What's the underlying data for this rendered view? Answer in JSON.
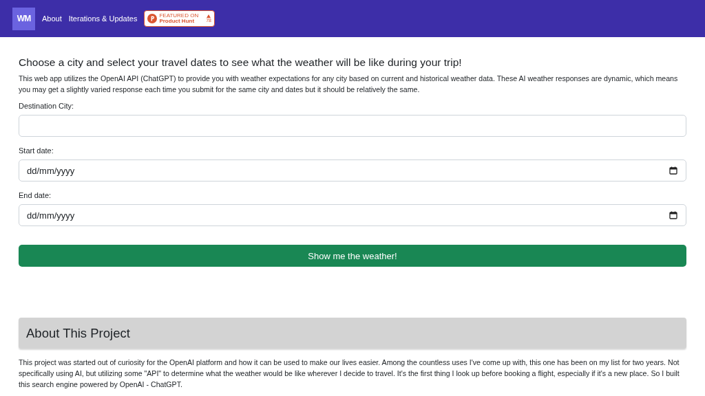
{
  "navbar": {
    "logo": "WM",
    "links": [
      "About",
      "Iterations & Updates"
    ],
    "badge": {
      "small": "FEATURED ON",
      "name": "Product Hunt",
      "count": "78"
    }
  },
  "form": {
    "heading": "Choose a city and select your travel dates to see what the weather will be like during your trip!",
    "intro": "This web app utilizes the OpenAI API (ChatGPT) to provide you with weather expectations for any city based on current and historical weather data. These AI weather responses are dynamic, which means you may get a slightly varied response each time you submit for the same city and dates but it should be relatively the same.",
    "fields": [
      {
        "kind": "text",
        "label": "Destination City:"
      },
      {
        "kind": "date",
        "label": "Start date:",
        "placeholder": "dd/mm/yyyy"
      },
      {
        "kind": "date",
        "label": "End date:",
        "placeholder": "dd/mm/yyyy"
      }
    ],
    "submit": "Show me the weather!"
  },
  "about": {
    "title": "About This Project",
    "text": "This project was started out of curiosity for the OpenAI platform and how it can be used to make our lives easier. Among the countless uses I've come up with, this one has been on my list for two years. Not specifically using AI, but utilizing some \"API\" to determine what the weather would be like wherever I decide to travel. It's the first thing I look up before booking a flight, especially if it's a new place. So I built this search engine powered by OpenAI - ChatGPT."
  }
}
